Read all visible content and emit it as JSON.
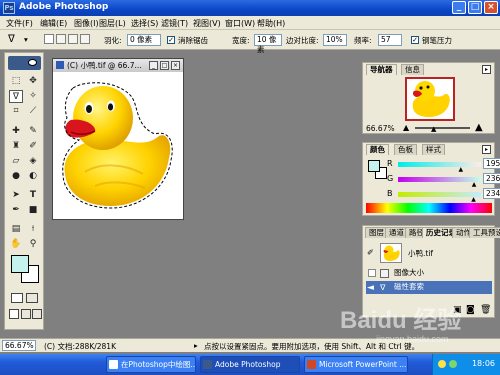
{
  "app": {
    "title": "Adobe Photoshop",
    "window_controls": {
      "minimize": "_",
      "maximize": "□",
      "close": "×"
    }
  },
  "menu": [
    "文件(F)",
    "编辑(E)",
    "图像(I)",
    "图层(L)",
    "选择(S)",
    "滤镜(T)",
    "视图(V)",
    "窗口(W)",
    "帮助(H)"
  ],
  "options": {
    "feather_label": "羽化:",
    "feather_value": "0 像素",
    "antialias_label": "消除锯齿",
    "width_label": "宽度:",
    "width_value": "10 像素",
    "edge_contrast_label": "边对比度:",
    "edge_contrast_value": "10%",
    "frequency_label": "频率:",
    "frequency_value": "57",
    "pen_pressure_label": "钢笔压力"
  },
  "toolbox": {
    "tool_icons": [
      "marquee-icon",
      "move-icon",
      "lasso-icon",
      "magic-wand-icon",
      "crop-icon",
      "slice-icon",
      "healing-icon",
      "brush-icon",
      "stamp-icon",
      "history-brush-icon",
      "eraser-icon",
      "bucket-icon",
      "blur-icon",
      "dodge-icon",
      "path-select-icon",
      "type-icon",
      "pen-icon",
      "shape-icon",
      "notes-icon",
      "eyedropper-icon",
      "hand-icon",
      "zoom-icon"
    ],
    "foreground_color": "#c6f2ee",
    "background_color": "#ffffff"
  },
  "document": {
    "title": "(C) 小鸭.tif @ 66.7...",
    "controls": {
      "minimize": "_",
      "maximize": "□",
      "close": "×"
    }
  },
  "navigator": {
    "tabs": [
      "导航器",
      "信息"
    ],
    "zoom": "66.67%"
  },
  "color_panel": {
    "tabs": [
      "颜色",
      "色板",
      "样式"
    ],
    "channels": [
      {
        "label": "R",
        "value": "195",
        "fraction": 0.765
      },
      {
        "label": "G",
        "value": "236",
        "fraction": 0.925
      },
      {
        "label": "B",
        "value": "234",
        "fraction": 0.918
      }
    ]
  },
  "history_panel": {
    "tabs": [
      "图层",
      "通道",
      "路径",
      "历史记录",
      "动作",
      "工具预设"
    ],
    "snapshot_label": "小鸭.tif",
    "items": [
      {
        "label": "图像大小",
        "selected": false
      },
      {
        "label": "磁性套索",
        "selected": true
      }
    ]
  },
  "status": {
    "zoom": "66.67%",
    "doc_size": "(C) 文档:288K/281K",
    "hint": "点按以设置紧固点。要用附加选项，使用 Shift、Alt 和 Ctrl 键。"
  },
  "taskbar": {
    "items": [
      {
        "label": "在Photoshop中绘图...",
        "active": false
      },
      {
        "label": "Adobe Photoshop",
        "active": true
      },
      {
        "label": "Microsoft PowerPoint ...",
        "active": false
      }
    ],
    "clock": "18:06"
  },
  "watermark": {
    "text": "Baidu 经验",
    "subtext": "jingyan.baidu.com"
  }
}
